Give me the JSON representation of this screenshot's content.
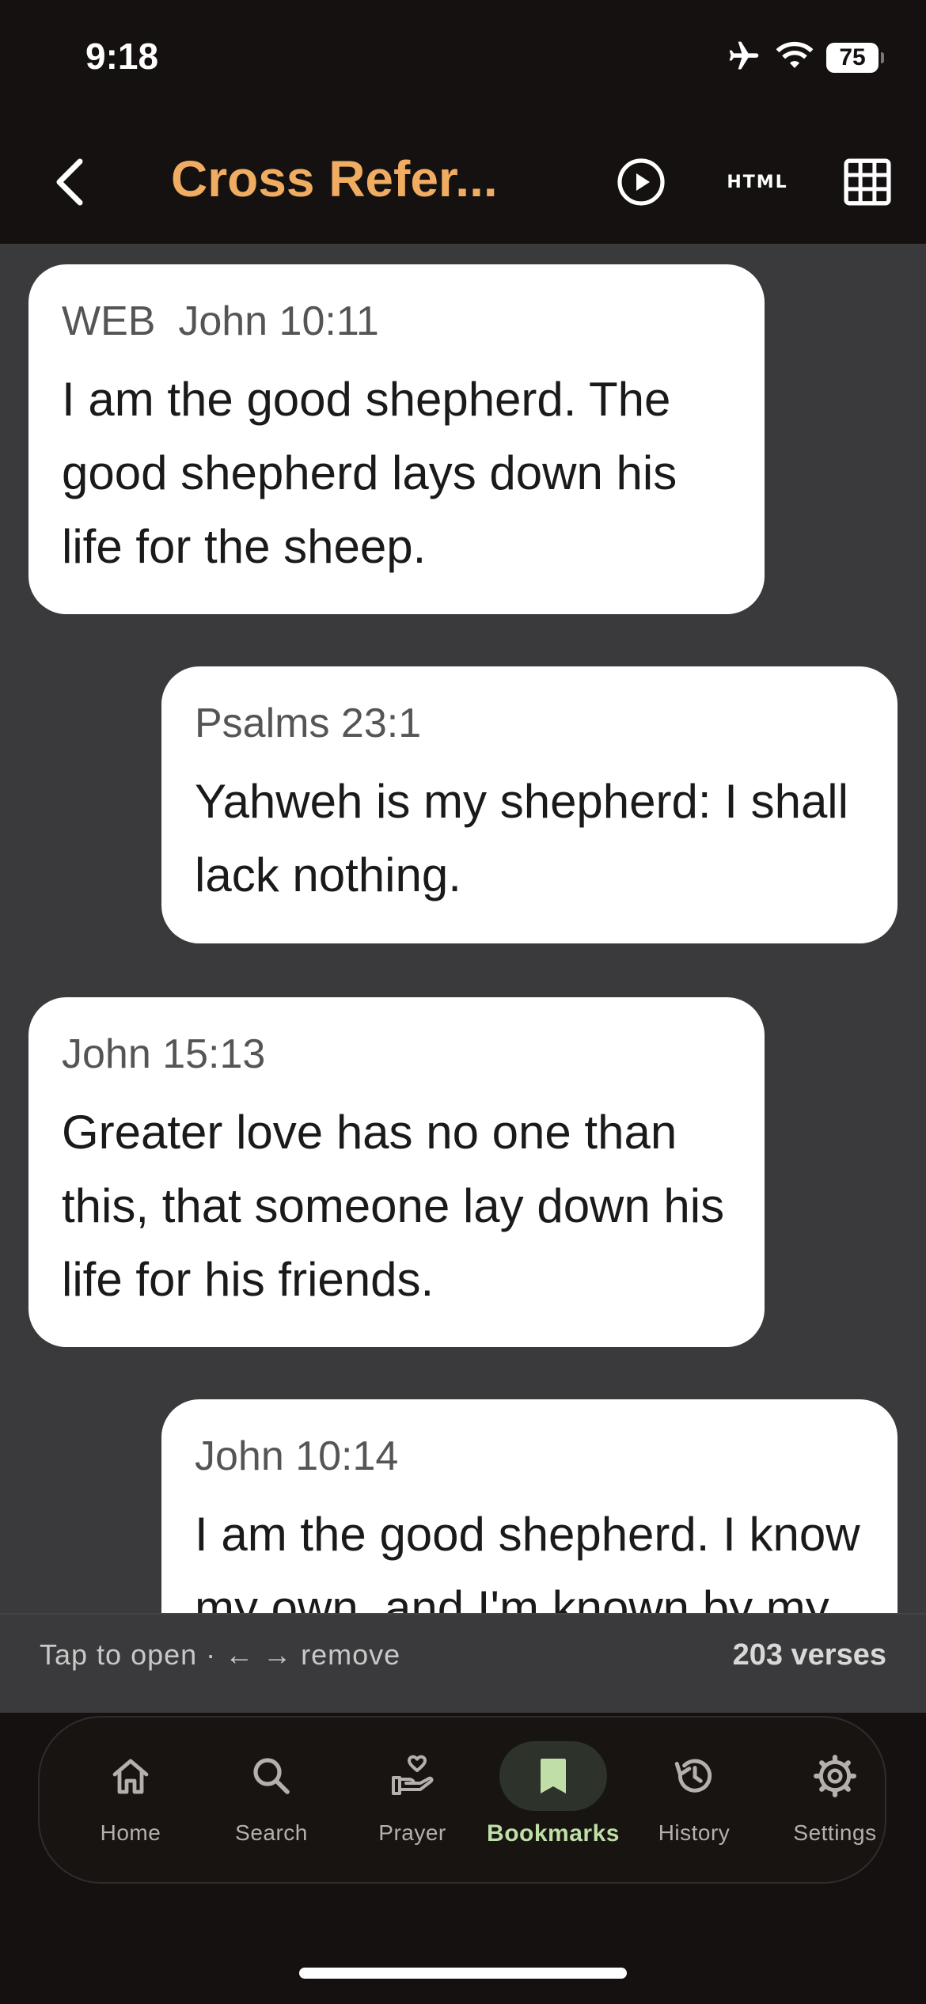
{
  "status_bar": {
    "time": "9:18",
    "battery": "75"
  },
  "header": {
    "title": "Cross Refer...",
    "html_button_label": "HTML"
  },
  "verses": [
    {
      "reference": "WEB  John 10:11",
      "text": "I am the good shepherd. The good shepherd lays down his life for the sheep."
    },
    {
      "reference": "Psalms 23:1",
      "text": "Yahweh is my shepherd: I shall lack nothing."
    },
    {
      "reference": "John 15:13",
      "text": "Greater love has no one than this, that someone lay down his life for his friends."
    },
    {
      "reference": "John 10:14",
      "text": "I am the good shepherd. I know my own, and I'm known by my own;"
    }
  ],
  "footer": {
    "hint": "Tap to open · ← → remove",
    "count": "203 verses"
  },
  "tabs": [
    {
      "label": "Home",
      "icon": "home-icon"
    },
    {
      "label": "Search",
      "icon": "search-icon"
    },
    {
      "label": "Prayer",
      "icon": "prayer-hand-heart-icon"
    },
    {
      "label": "Bookmarks",
      "icon": "bookmark-icon",
      "active": true
    },
    {
      "label": "History",
      "icon": "history-icon"
    },
    {
      "label": "Settings",
      "icon": "gear-icon"
    }
  ],
  "colors": {
    "accent_title": "#f0ad62",
    "active_tab": "#bfdfa6",
    "content_bg": "#3a3a3c"
  }
}
